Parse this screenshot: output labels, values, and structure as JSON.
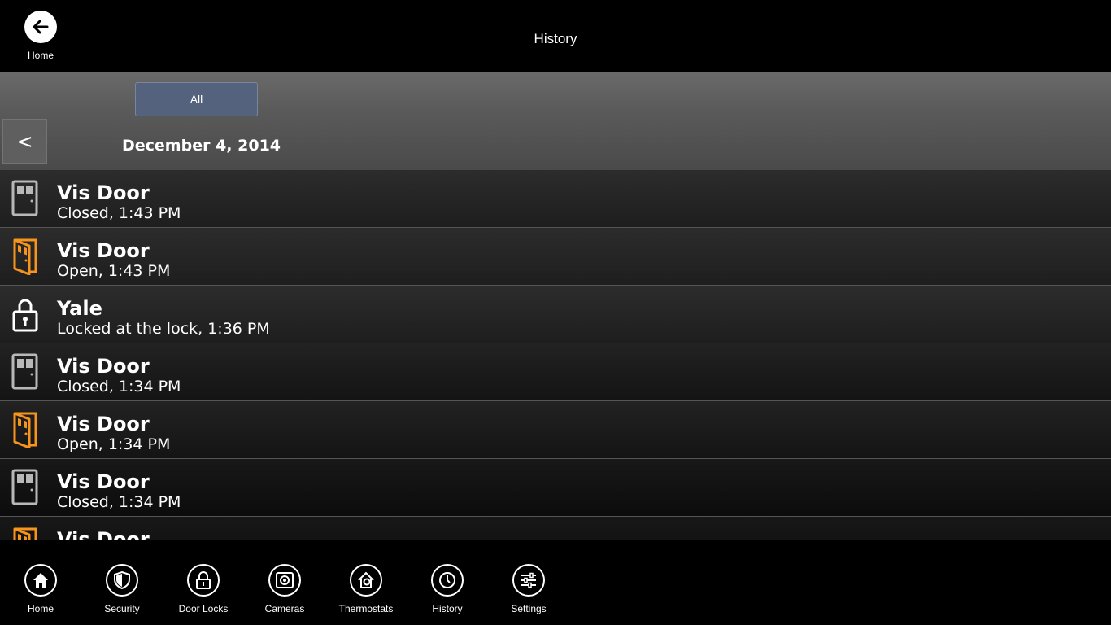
{
  "header": {
    "back_label": "Home",
    "title": "History"
  },
  "filter": {
    "selected_label": "All",
    "prev_label": "<",
    "date": "December 4, 2014"
  },
  "events": [
    {
      "title": "Vis Door",
      "detail": "Closed, 1:43 PM",
      "icon": "door-closed-icon"
    },
    {
      "title": "Vis Door",
      "detail": "Open, 1:43 PM",
      "icon": "door-open-icon"
    },
    {
      "title": "Yale",
      "detail": "Locked at the lock, 1:36 PM",
      "icon": "padlock-icon"
    },
    {
      "title": "Vis Door",
      "detail": "Closed, 1:34 PM",
      "icon": "door-closed-icon"
    },
    {
      "title": "Vis Door",
      "detail": "Open, 1:34 PM",
      "icon": "door-open-icon"
    },
    {
      "title": "Vis Door",
      "detail": "Closed, 1:34 PM",
      "icon": "door-closed-icon"
    },
    {
      "title": "Vis Door",
      "detail": "",
      "icon": "door-open-icon"
    }
  ],
  "nav": [
    {
      "label": "Home",
      "icon": "home-icon"
    },
    {
      "label": "Security",
      "icon": "shield-icon"
    },
    {
      "label": "Door Locks",
      "icon": "lock-icon"
    },
    {
      "label": "Cameras",
      "icon": "camera-icon"
    },
    {
      "label": "Thermostats",
      "icon": "thermostat-icon"
    },
    {
      "label": "History",
      "icon": "clock-icon"
    },
    {
      "label": "Settings",
      "icon": "sliders-icon"
    }
  ],
  "colors": {
    "open_door": "#f7941d",
    "closed_door": "#b8b8b8",
    "filter_selected": "#55627e"
  }
}
